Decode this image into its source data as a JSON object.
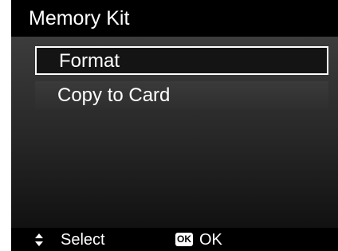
{
  "header": {
    "title": "Memory Kit"
  },
  "menu": {
    "items": [
      {
        "label": "Format",
        "selected": true
      },
      {
        "label": "Copy to Card",
        "selected": false
      }
    ]
  },
  "footer": {
    "select_icon": "up-down-arrows-icon",
    "select_label": "Select",
    "ok_icon_text": "OK",
    "ok_label": "OK"
  }
}
